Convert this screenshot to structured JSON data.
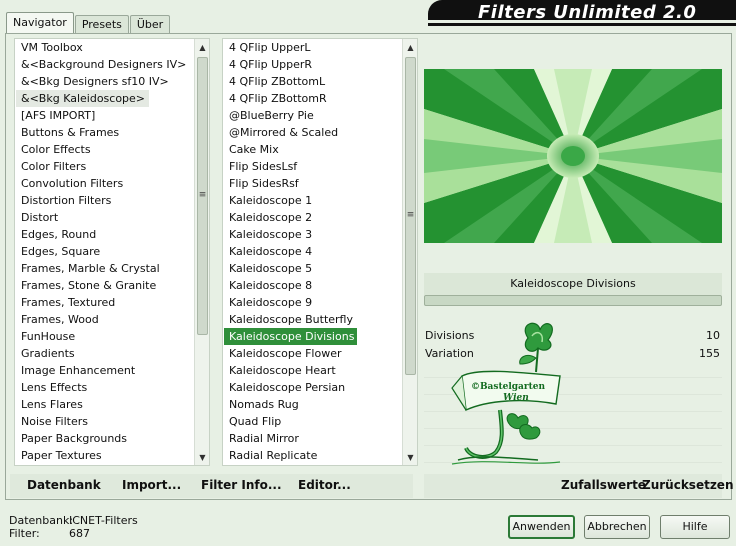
{
  "app": {
    "title": "Filters Unlimited 2.0"
  },
  "tabs": [
    {
      "label": "Navigator"
    },
    {
      "label": "Presets"
    },
    {
      "label": "Über"
    }
  ],
  "categories": {
    "items": [
      "VM Toolbox",
      "&<Background Designers IV>",
      "&<Bkg Designers sf10 IV>",
      "&<Bkg Kaleidoscope>",
      "[AFS IMPORT]",
      "Buttons & Frames",
      "Color Effects",
      "Color Filters",
      "Convolution Filters",
      "Distortion Filters",
      "Distort",
      "Edges, Round",
      "Edges, Square",
      "Frames, Marble & Crystal",
      "Frames, Stone & Granite",
      "Frames, Textured",
      "Frames, Wood",
      "FunHouse",
      "Gradients",
      "Image Enhancement",
      "Lens Effects",
      "Lens Flares",
      "Noise Filters",
      "Paper Backgrounds",
      "Paper Textures"
    ],
    "selected_index": 3
  },
  "filters": {
    "items": [
      "4 QFlip UpperL",
      "4 QFlip UpperR",
      "4 QFlip ZBottomL",
      "4 QFlip ZBottomR",
      "@BlueBerry Pie",
      "@Mirrored & Scaled",
      "Cake Mix",
      "Flip SidesLsf",
      "Flip SidesRsf",
      "Kaleidoscope 1",
      "Kaleidoscope 2",
      "Kaleidoscope 3",
      "Kaleidoscope 4",
      "Kaleidoscope 5",
      "Kaleidoscope 8",
      "Kaleidoscope 9",
      "Kaleidoscope Butterfly",
      "Kaleidoscope Divisions",
      "Kaleidoscope Flower",
      "Kaleidoscope Heart",
      "Kaleidoscope Persian",
      "Nomads Rug",
      "Quad Flip",
      "Radial Mirror",
      "Radial Replicate"
    ],
    "selected_index": 17
  },
  "filter_panel": {
    "name": "Kaleidoscope Divisions",
    "params": [
      {
        "label": "Divisions",
        "value": "10"
      },
      {
        "label": "Variation",
        "value": "155"
      }
    ]
  },
  "toolbar_left": {
    "database": "Datenbank",
    "import": "Import...",
    "filter_info": "Filter Info...",
    "editor": "Editor..."
  },
  "toolbar_right": {
    "random": "Zufallswerte",
    "reset": "Zurücksetzen"
  },
  "status": {
    "database_label": "Datenbank:",
    "database_value": "ICNET-Filters",
    "filter_label": "Filter:",
    "filter_value": "687"
  },
  "buttons": {
    "apply": "Anwenden",
    "cancel": "Abbrechen",
    "help": "Hilfe"
  },
  "watermark": {
    "line1": "©Bastelgarten",
    "line2": "Wien"
  },
  "colors": {
    "accent": "#2f8f3a",
    "background": "#e7f0e4",
    "banner": "#101010",
    "preview_dark": "#1f8a2c",
    "preview_light": "#d8f2c8"
  }
}
